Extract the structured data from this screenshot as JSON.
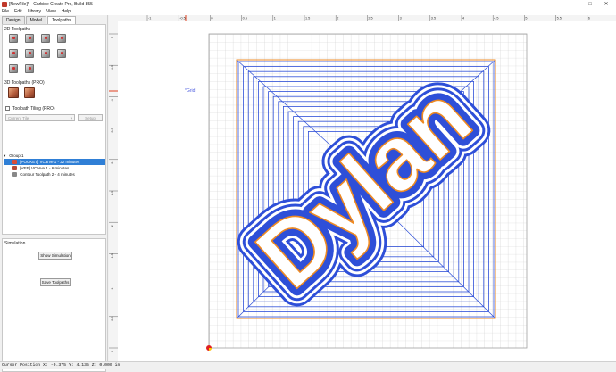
{
  "window": {
    "title": "[NewFile]* - Carbide Create Pro, Build 855",
    "minimize": "—",
    "maximize": "□",
    "close": "✕"
  },
  "menu": [
    "File",
    "Edit",
    "Library",
    "View",
    "Help"
  ],
  "tabs": [
    "Design",
    "Model",
    "Toolpaths"
  ],
  "toolpaths_panel": {
    "section_2d": "2D Toolpaths",
    "section_3d": "3D Toolpaths (PRO)",
    "tiling_label": "Toolpath Tiling (PRO)",
    "current_tile_label": "Current Tile",
    "setup_button": "Setup"
  },
  "tree": {
    "group": "Group 1",
    "items": [
      "[POCKET] VCarve 1 - 22 minutes",
      "[VEE] VCarve 1 - 6 minutes",
      "Contour Toolpath 2 - 4 minutes"
    ]
  },
  "simulation": {
    "header": "Simulation",
    "show_button": "Show Simulation",
    "save_button": "Save Toolpaths"
  },
  "canvas": {
    "grid_label": "*Grid",
    "design_text": "Dylan",
    "colors": {
      "toolpath": "#2e4fd8",
      "outline": "#ee8a22"
    },
    "ruler_x": [
      "-1",
      "-0.5",
      "0",
      "0.5",
      "1",
      "1.5",
      "2",
      "2.5",
      "3",
      "3.5",
      "4",
      "4.5",
      "5",
      "5.5",
      "6",
      "6.5"
    ],
    "ruler_y": [
      "5",
      "4.5",
      "4",
      "3.5",
      "3",
      "2.5",
      "2",
      "1.5",
      "1",
      "0.5",
      "0",
      "-0.5"
    ]
  },
  "status": "Cursor Position X: -0.375 Y: 4.135 Z: 0.000 in"
}
